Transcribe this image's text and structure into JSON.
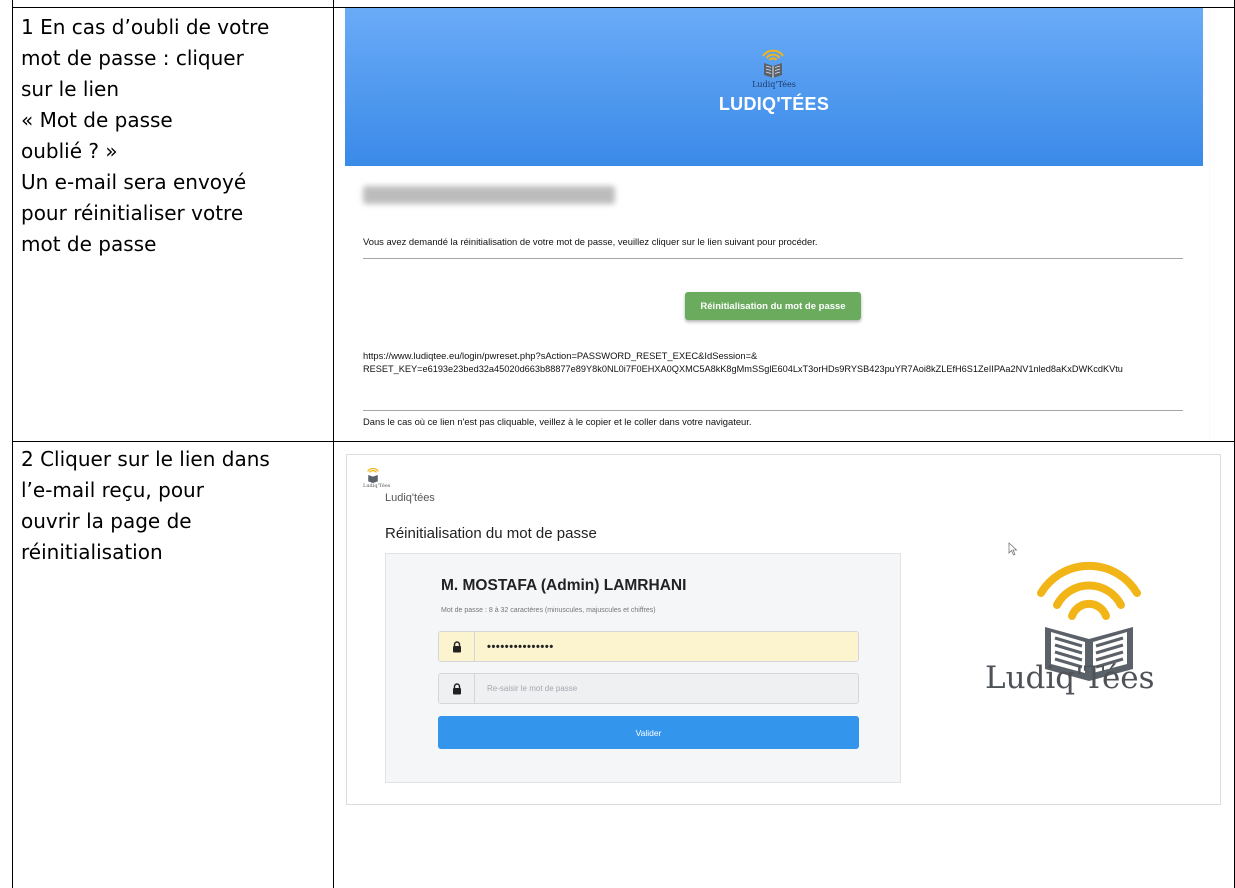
{
  "step1": {
    "lines": [
      "1 En cas d’oubli de votre",
      "mot de passe : cliquer",
      "sur le lien",
      "« Mot de passe",
      "oublié ? »",
      "Un e-mail sera envoyé",
      "pour réinitialiser votre",
      "mot de passe"
    ]
  },
  "step2": {
    "lines": [
      "2 Cliquer sur le lien dans",
      "l’e-mail reçu, pour",
      "ouvrir la page de",
      "réinitialisation"
    ]
  },
  "email": {
    "logo_text": "Ludiq'Tées",
    "brand": "LUDIQ'TÉES",
    "recipient_name_blurred": "MOSTAFA (Admin) LAMRHANI",
    "intro": "Vous avez demandé la réinitialisation de votre mot de passe, veuillez cliquer sur le lien suivant pour procéder.",
    "reset_button": "Réinitialisation du mot de passe",
    "link_line1": "https://www.ludiqtee.eu/login/pwreset.php?sAction=PASSWORD_RESET_EXEC&IdSession=&",
    "link_line2": "RESET_KEY=e6193e23bed32a45020d663b88877e89Y8k0NL0i7F0EHXA0QXMC5A8kK8gMmSSglE604LxT3orHDs9RYSB423puYR7Aoi8kZLEfH6S1ZeIIPAa2NV1nled8aKxDWKcdKVtu",
    "footer": "Dans le cas où ce lien n'est pas cliquable, veillez à le copier et le coller dans votre navigateur."
  },
  "reset_page": {
    "small_logo_text": "Ludiq'Tées",
    "app_name": "Ludiq'tées",
    "title": "Réinitialisation du mot de passe",
    "user_name": "M. MOSTAFA (Admin) LAMRHANI",
    "password_hint": "Mot de passe : 8 à 32 caractères (minuscules, majuscules et chiffres)",
    "password_value": "•••••••••••••••",
    "confirm_placeholder": "Re-saisir le mot de passe",
    "submit_label": "Valider",
    "big_logo_text": "Ludiq'Tées"
  },
  "colors": {
    "email_header": "#3a8ae8",
    "reset_button": "#6aab5e",
    "submit_button": "#3396ec",
    "logo_gold": "#f2b517",
    "logo_gray": "#5b6168"
  }
}
